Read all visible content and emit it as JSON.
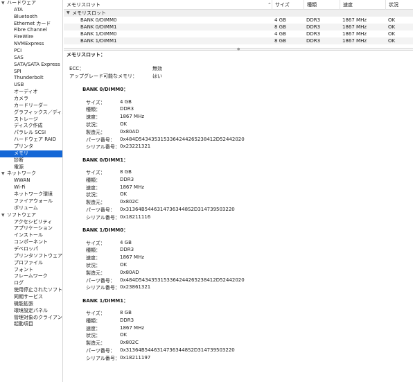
{
  "sidebar": [
    {
      "label": "ハードウェア",
      "group": true
    },
    {
      "label": "ATA"
    },
    {
      "label": "Bluetooth"
    },
    {
      "label": "Ethernet カード"
    },
    {
      "label": "Fibre Channel"
    },
    {
      "label": "FireWire"
    },
    {
      "label": "NVMExpress"
    },
    {
      "label": "PCI"
    },
    {
      "label": "SAS"
    },
    {
      "label": "SATA/SATA Express"
    },
    {
      "label": "SPI"
    },
    {
      "label": "Thunderbolt"
    },
    {
      "label": "USB"
    },
    {
      "label": "オーディオ"
    },
    {
      "label": "カメラ"
    },
    {
      "label": "カードリーダー"
    },
    {
      "label": "グラフィックス／ディ…"
    },
    {
      "label": "ストレージ"
    },
    {
      "label": "ディスク作成"
    },
    {
      "label": "パラレル SCSI"
    },
    {
      "label": "ハードウェア RAID"
    },
    {
      "label": "プリンタ"
    },
    {
      "label": "メモリ",
      "selected": true
    },
    {
      "label": "診断"
    },
    {
      "label": "電源"
    },
    {
      "label": "ネットワーク",
      "group": true
    },
    {
      "label": "WWAN"
    },
    {
      "label": "Wi-Fi"
    },
    {
      "label": "ネットワーク環境"
    },
    {
      "label": "ファイアウォール"
    },
    {
      "label": "ボリューム"
    },
    {
      "label": "ソフトウェア",
      "group": true
    },
    {
      "label": "アクセシビリティ"
    },
    {
      "label": "アプリケーション"
    },
    {
      "label": "インストール"
    },
    {
      "label": "コンポーネント"
    },
    {
      "label": "デベロッパ"
    },
    {
      "label": "プリンタソフトウェア"
    },
    {
      "label": "プロファイル"
    },
    {
      "label": "フォント"
    },
    {
      "label": "フレームワーク"
    },
    {
      "label": "ログ"
    },
    {
      "label": "使用停止されたソフト…"
    },
    {
      "label": "同期サービス"
    },
    {
      "label": "機能拡張"
    },
    {
      "label": "環境設定パネル"
    },
    {
      "label": "管理対象のクライアン…"
    },
    {
      "label": "起動項目"
    }
  ],
  "table": {
    "headers": [
      "メモリスロット",
      "サイズ",
      "種類",
      "速度",
      "状況"
    ],
    "sort_icon": "chevron-up-icon",
    "group_label": "メモリスロット",
    "rows": [
      [
        "BANK 0/DIMM0",
        "4 GB",
        "DDR3",
        "1867 MHz",
        "OK"
      ],
      [
        "BANK 0/DIMM1",
        "8 GB",
        "DDR3",
        "1867 MHz",
        "OK"
      ],
      [
        "BANK 1/DIMM0",
        "4 GB",
        "DDR3",
        "1867 MHz",
        "OK"
      ],
      [
        "BANK 1/DIMM1",
        "8 GB",
        "DDR3",
        "1867 MHz",
        "OK"
      ]
    ]
  },
  "detail": {
    "title": "メモリスロット：",
    "ecc_label": "ECC：",
    "ecc_value": "無効",
    "upgrade_label": "アップグレード可能なメモリ：",
    "upgrade_value": "はい",
    "banks": [
      {
        "title": "BANK 0/DIMM0：",
        "fields": [
          [
            "サイズ：",
            "4 GB"
          ],
          [
            "種類：",
            "DDR3"
          ],
          [
            "速度：",
            "1867 MHz"
          ],
          [
            "状況：",
            "OK"
          ],
          [
            "製造元：",
            "0x80AD"
          ],
          [
            "パーツ番号：",
            "0x484D5434353153364244265238412D52442020"
          ],
          [
            "シリアル番号：",
            "0x23221321"
          ]
        ]
      },
      {
        "title": "BANK 0/DIMM1：",
        "fields": [
          [
            "サイズ：",
            "8 GB"
          ],
          [
            "種類：",
            "DDR3"
          ],
          [
            "速度：",
            "1867 MHz"
          ],
          [
            "状況：",
            "OK"
          ],
          [
            "製造元：",
            "0x802C"
          ],
          [
            "パーツ番号：",
            "0x31364B54463147363448S2D314739503220"
          ],
          [
            "シリアル番号：",
            "0x18211116"
          ]
        ]
      },
      {
        "title": "BANK 1/DIMM0：",
        "fields": [
          [
            "サイズ：",
            "4 GB"
          ],
          [
            "種類：",
            "DDR3"
          ],
          [
            "速度：",
            "1867 MHz"
          ],
          [
            "状況：",
            "OK"
          ],
          [
            "製造元：",
            "0x80AD"
          ],
          [
            "パーツ番号：",
            "0x484D5434353153364244265238412D52442020"
          ],
          [
            "シリアル番号：",
            "0x23861321"
          ]
        ]
      },
      {
        "title": "BANK 1/DIMM1：",
        "fields": [
          [
            "サイズ：",
            "8 GB"
          ],
          [
            "種類：",
            "DDR3"
          ],
          [
            "速度：",
            "1867 MHz"
          ],
          [
            "状況：",
            "OK"
          ],
          [
            "製造元：",
            "0x802C"
          ],
          [
            "パーツ番号：",
            "0x31364B54463147363448S2D314739503220"
          ],
          [
            "シリアル番号：",
            "0x18211197"
          ]
        ]
      }
    ]
  }
}
